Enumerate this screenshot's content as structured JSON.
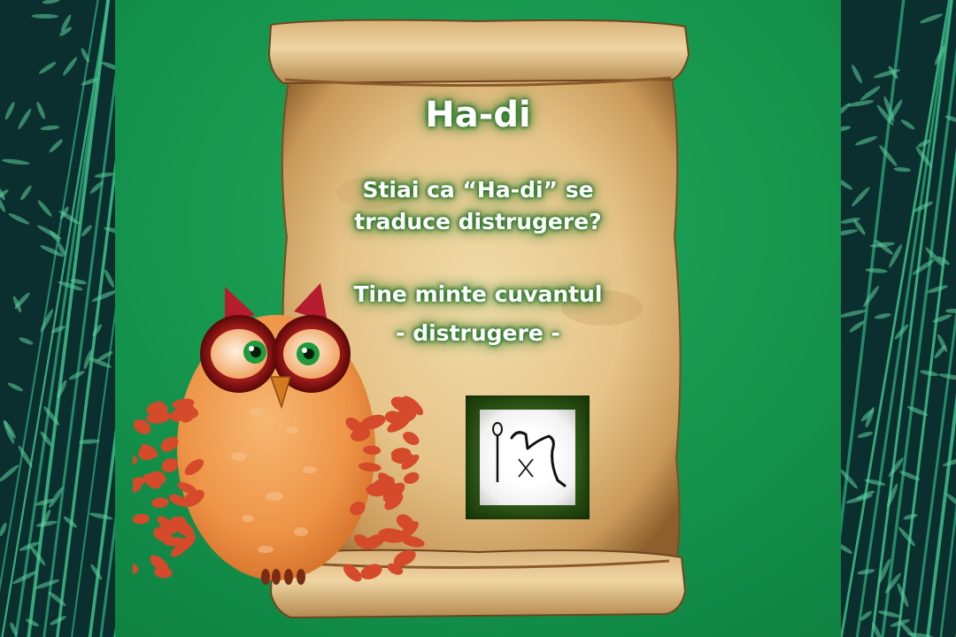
{
  "card": {
    "title": "Ha-di",
    "question_line_1": "Stiai ca “Ha-di” se",
    "question_line_2": "traduce distrugere?",
    "reminder_line_1": "Tine minte cuvantul",
    "reminder_line_2": "- distrugere -"
  },
  "colors": {
    "background_green": "#13904a",
    "bamboo_dark": "#0b2f2e",
    "bamboo_light": "#3fbf8a",
    "parchment": "#e9c991",
    "text_glow": "#2c7d2c",
    "owl_orange": "#f0954a",
    "owl_feather": "#d44a2a",
    "owl_eye_ring": "#7a1010",
    "owl_iris": "#1f9a3c",
    "hieroglyph_frame": "#2f5717"
  },
  "icons": [
    "owl-mascot",
    "hieroglyph-ha-di",
    "bamboo-pattern",
    "parchment-scroll"
  ]
}
